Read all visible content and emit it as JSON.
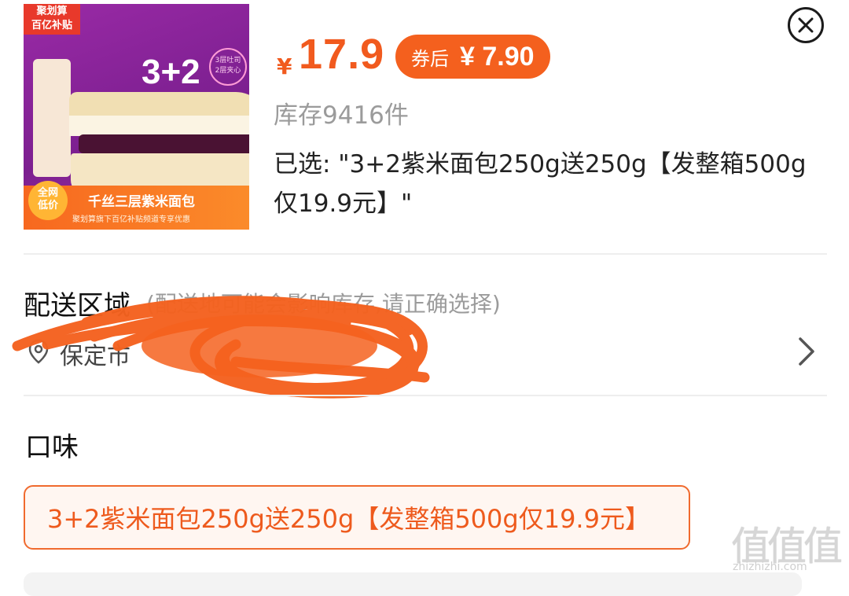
{
  "product": {
    "image": {
      "corner_tag": "聚划算\n百亿补贴",
      "count_text": "3+2",
      "layer_note": "3层吐司\n2层夹心",
      "low_price_badge": "全网\n低价",
      "banner_text": "千丝三层紫米面包",
      "banner_subtext": "聚划算旗下百亿补贴频道专享优惠"
    },
    "currency_symbol": "¥",
    "price": "17.9",
    "coupon_label": "券后",
    "coupon_price": "¥ 7.90",
    "stock": "库存9416件",
    "selected_text": "已选: \"3+2紫米面包250g送250g【发整箱500g仅19.9元】\""
  },
  "delivery": {
    "title": "配送区域",
    "hint": "(配送地可能会影响库存,请正确选择)",
    "address": "保定市"
  },
  "flavor": {
    "title": "口味",
    "options": [
      {
        "label": "3+2紫米面包250g送250g【发整箱500g仅19.9元】",
        "selected": true
      }
    ]
  },
  "watermark": {
    "logo": "值值值",
    "site": "zhizhizhi.com"
  },
  "colors": {
    "accent": "#f15a1e",
    "scribble": "#f4621f"
  }
}
